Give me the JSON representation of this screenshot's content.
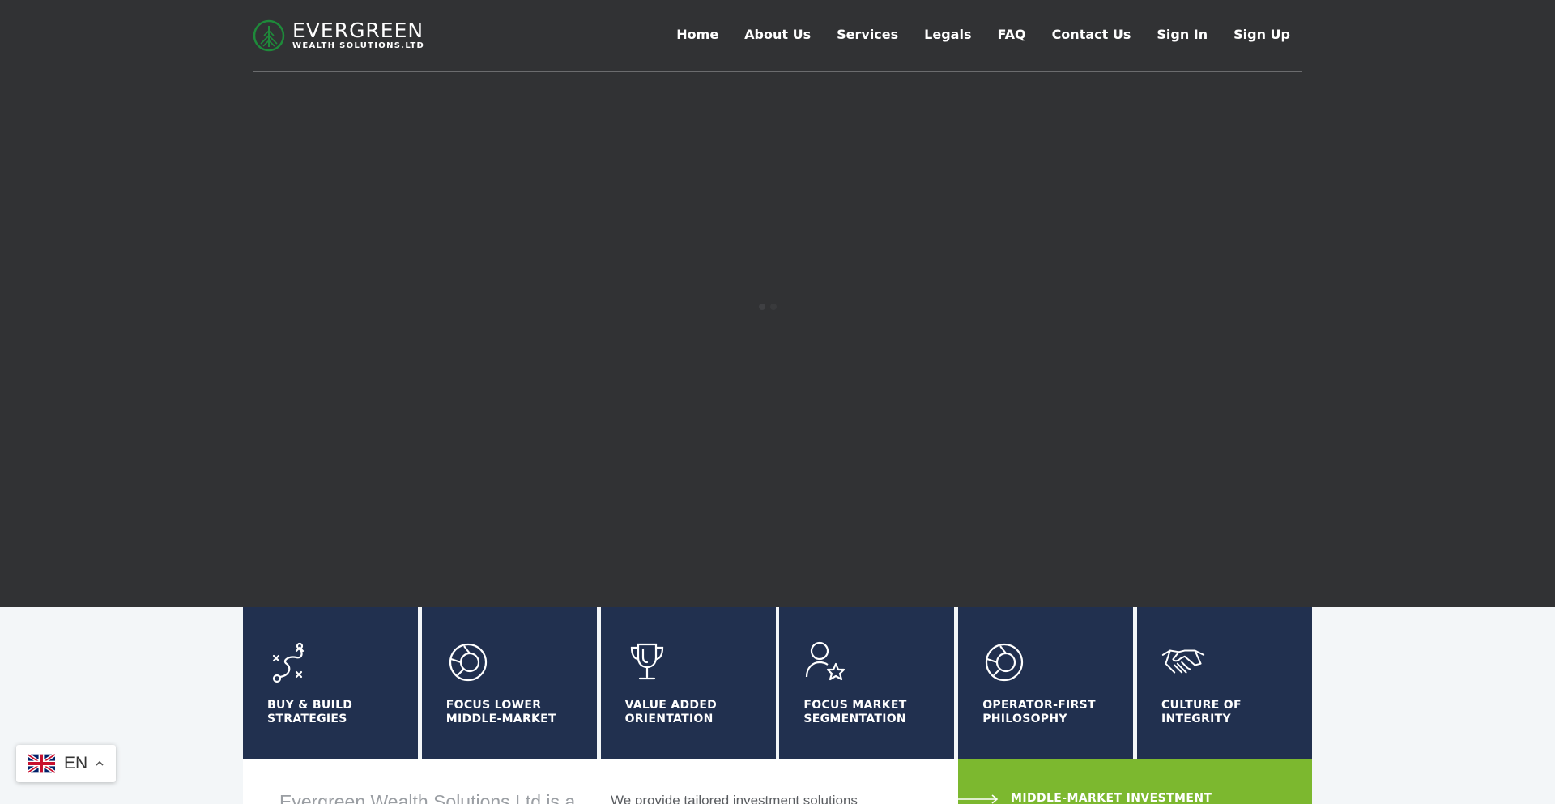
{
  "header": {
    "brand_name": "EVERGREEN",
    "brand_sub": "WEALTH SOLUTIONS.LTD",
    "nav": [
      "Home",
      "About Us",
      "Services",
      "Legals",
      "FAQ",
      "Contact Us",
      "Sign In",
      "Sign Up"
    ]
  },
  "features": [
    {
      "label": "BUY & BUILD\nSTRATEGIES",
      "icon": "strategy-icon"
    },
    {
      "label": "FOCUS LOWER\nMIDDLE-MARKET",
      "icon": "pie-chart-icon"
    },
    {
      "label": "VALUE ADDED\nORIENTATION",
      "icon": "trophy-icon"
    },
    {
      "label": "FOCUS MARKET\nSEGMENTATION",
      "icon": "user-star-icon"
    },
    {
      "label": "OPERATOR-FIRST\nPHILOSOPHY",
      "icon": "pie-chart-icon"
    },
    {
      "label": "CULTURE OF\nINTEGRITY",
      "icon": "handshake-icon"
    }
  ],
  "intro": {
    "lead": "Evergreen Wealth Solutions Ltd is a",
    "body": "We provide tailored investment solutions"
  },
  "cta": {
    "label": "MIDDLE-MARKET INVESTMENT"
  },
  "language": {
    "code": "EN",
    "flag": "uk-flag-icon"
  },
  "colors": {
    "hero_bg": "#313234",
    "tile_bg": "#21304f",
    "accent_green": "#7cb82f",
    "logo_green": "#1e8a3a"
  }
}
